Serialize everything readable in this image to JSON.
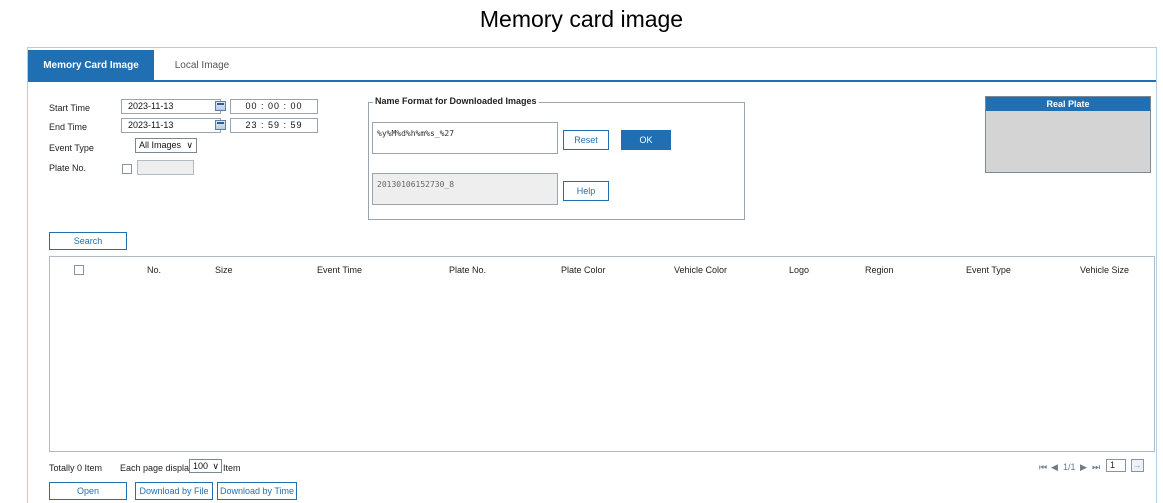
{
  "caption": "Memory card image",
  "tabs": [
    {
      "label": "Memory Card Image",
      "active": true
    },
    {
      "label": "Local Image",
      "active": false
    }
  ],
  "search_form": {
    "start_time_label": "Start Time",
    "start_date": "2023-11-13",
    "start_clock": "00 :  00 :  00",
    "end_time_label": "End Time",
    "end_date": "2023-11-13",
    "end_clock": "23 :  59 :  59",
    "event_type_label": "Event Type",
    "event_type_value": "All Images",
    "plate_no_label": "Plate No.",
    "plate_no_value": ""
  },
  "name_format": {
    "legend": "Name Format for Downloaded Images",
    "format_value": "%y%M%d%h%m%s_%27",
    "reset_label": "Reset",
    "ok_label": "OK",
    "preview_value": "20130106152730_8",
    "help_label": "Help"
  },
  "real_plate": {
    "title": "Real Plate"
  },
  "search_label": "Search",
  "table": {
    "columns": [
      "No.",
      "Size",
      "Event Time",
      "Plate No.",
      "Plate Color",
      "Vehicle Color",
      "Logo",
      "Region",
      "Event Type",
      "Vehicle Size"
    ]
  },
  "footer": {
    "total_text": "Totally 0 Item",
    "each_page_label": "Each page displays",
    "page_size": "100",
    "item_label": "Item",
    "page_indicator": "1/1",
    "page_input": "1"
  },
  "actions": {
    "open_label": "Open",
    "download_file_label": "Download by File",
    "download_time_label": "Download by Time"
  },
  "colors": {
    "accent": "#1f6fb2",
    "panel_grey": "#d4d4d4"
  }
}
